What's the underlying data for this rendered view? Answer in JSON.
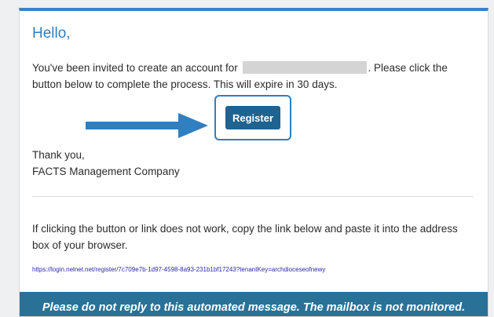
{
  "email": {
    "greeting": "Hello,",
    "intro_before": "You've been invited to create an account for",
    "intro_after": ". Please click the button below to complete the process. This will expire in 30 days.",
    "register_label": "Register",
    "closing_thanks": "Thank you,",
    "closing_signature": "FACTS Management Company",
    "fallback_text": "If clicking the button or link does not work, copy the link below and paste it into the address box of your browser.",
    "link_url": "https://login.nelnet.net/register/7c709e7b-1d97-4598-8a93-231b1bf17243?tenantKey=archdioceseofnewy",
    "footer_notice": "Please do not reply to this automated message. The mailbox is not monitored."
  },
  "colors": {
    "accent": "#2f7fc1",
    "button": "#1f6390",
    "footer": "#2a7197"
  },
  "icons": {
    "pointer_arrow": "arrow-right-icon"
  }
}
